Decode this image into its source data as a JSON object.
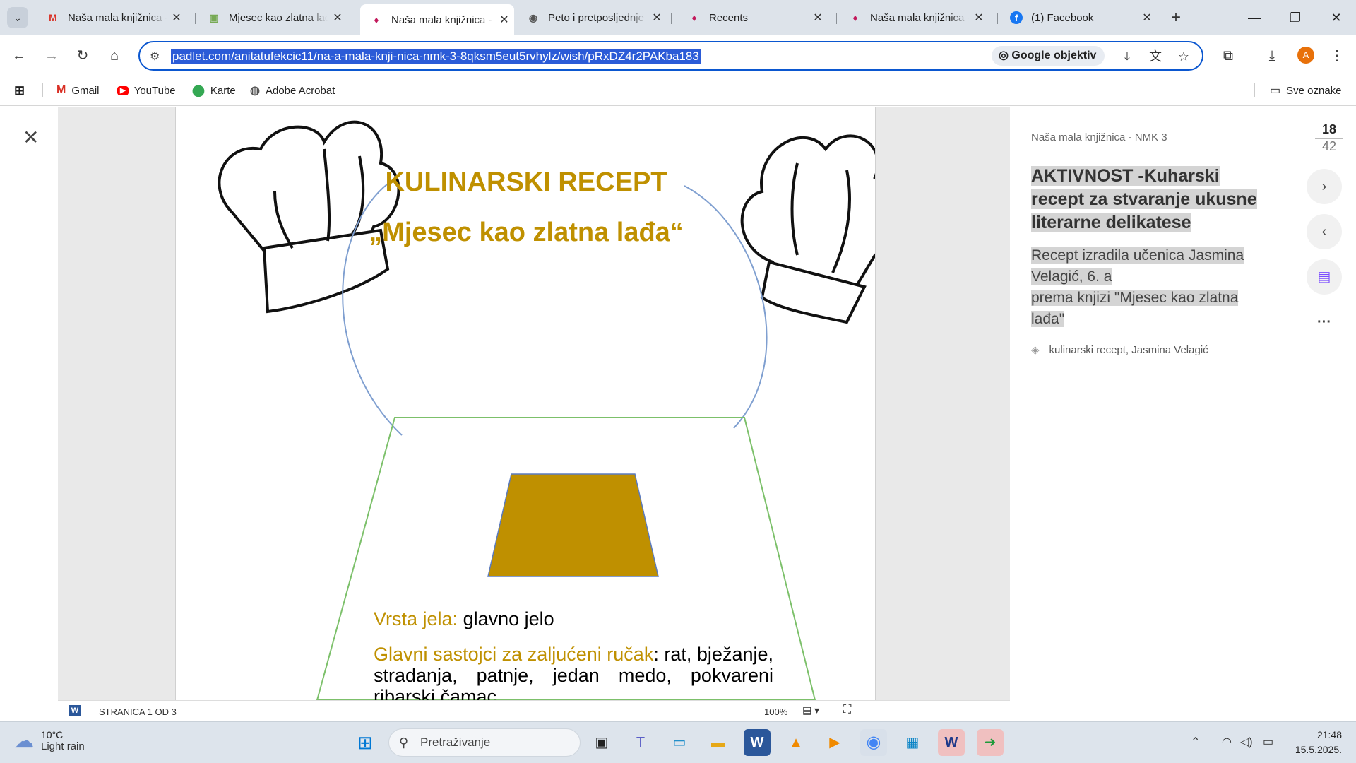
{
  "browser": {
    "tabs": [
      {
        "title": "Naša mala knjižnica -",
        "favicon": "gmail-icon",
        "active": false
      },
      {
        "title": "Mjesec kao zlatna lađ",
        "favicon": "book-icon",
        "active": false
      },
      {
        "title": "Naša mala knjižnica -",
        "favicon": "padlet-icon",
        "active": true
      },
      {
        "title": "Peto i pretposljednje",
        "favicon": "globe-icon",
        "active": false
      },
      {
        "title": "Recents",
        "favicon": "padlet-icon",
        "active": false
      },
      {
        "title": "Naša mala knjižnica -",
        "favicon": "padlet-icon",
        "active": false
      },
      {
        "title": "(1) Facebook",
        "favicon": "facebook-icon",
        "active": false
      }
    ],
    "url": "padlet.com/anitatufekcic11/na-a-mala-knji-nica-nmk-3-8qksm5eut5rvhylz/wish/pRxDZ4r2PAKba183",
    "lens_label": "Google objektiv",
    "profile_initial": "A",
    "bookmarks": [
      {
        "label": "Gmail",
        "icon": "gmail-icon"
      },
      {
        "label": "YouTube",
        "icon": "youtube-icon"
      },
      {
        "label": "Karte",
        "icon": "maps-icon"
      },
      {
        "label": "Adobe Acrobat",
        "icon": "acrobat-icon"
      }
    ],
    "all_bookmarks_label": "Sve oznake"
  },
  "document": {
    "title": "KULINARSKI RECEPT",
    "subtitle": "„Mjesec kao zlatna lađa“",
    "dish_type_label": "Vrsta jela:",
    "dish_type_value": " glavno jelo",
    "ingredients_label": "Glavni sastojci za zaljućeni ručak",
    "ingredients_value": ": rat, bježanje, stradanja, patnje, jedan medo, pokvareni ribarski čamac",
    "page_indicator": "STRANICA 1 OD 3",
    "zoom": "100%"
  },
  "post": {
    "board": "Naša mala knjižnica  - NMK 3",
    "title": "AKTIVNOST -Kuharski recept za stvaranje ukusne literarne delikatese",
    "description_line1": "Recept izradila učenica Jasmina Velagić, 6. a",
    "description_line2": "prema knjizi \"Mjesec kao zlatna lađa\"",
    "tags": "kulinarski recept, Jasmina Velagić",
    "counter_current": "18",
    "counter_total": "42"
  },
  "taskbar": {
    "temperature": "10°C",
    "weather": "Light rain",
    "search_placeholder": "Pretraživanje",
    "time": "21:48",
    "date": "15.5.2025."
  },
  "colors": {
    "accent_gold": "#bf9000",
    "url_highlight": "#2b5bd7",
    "tab_bar": "#dde3ea"
  }
}
